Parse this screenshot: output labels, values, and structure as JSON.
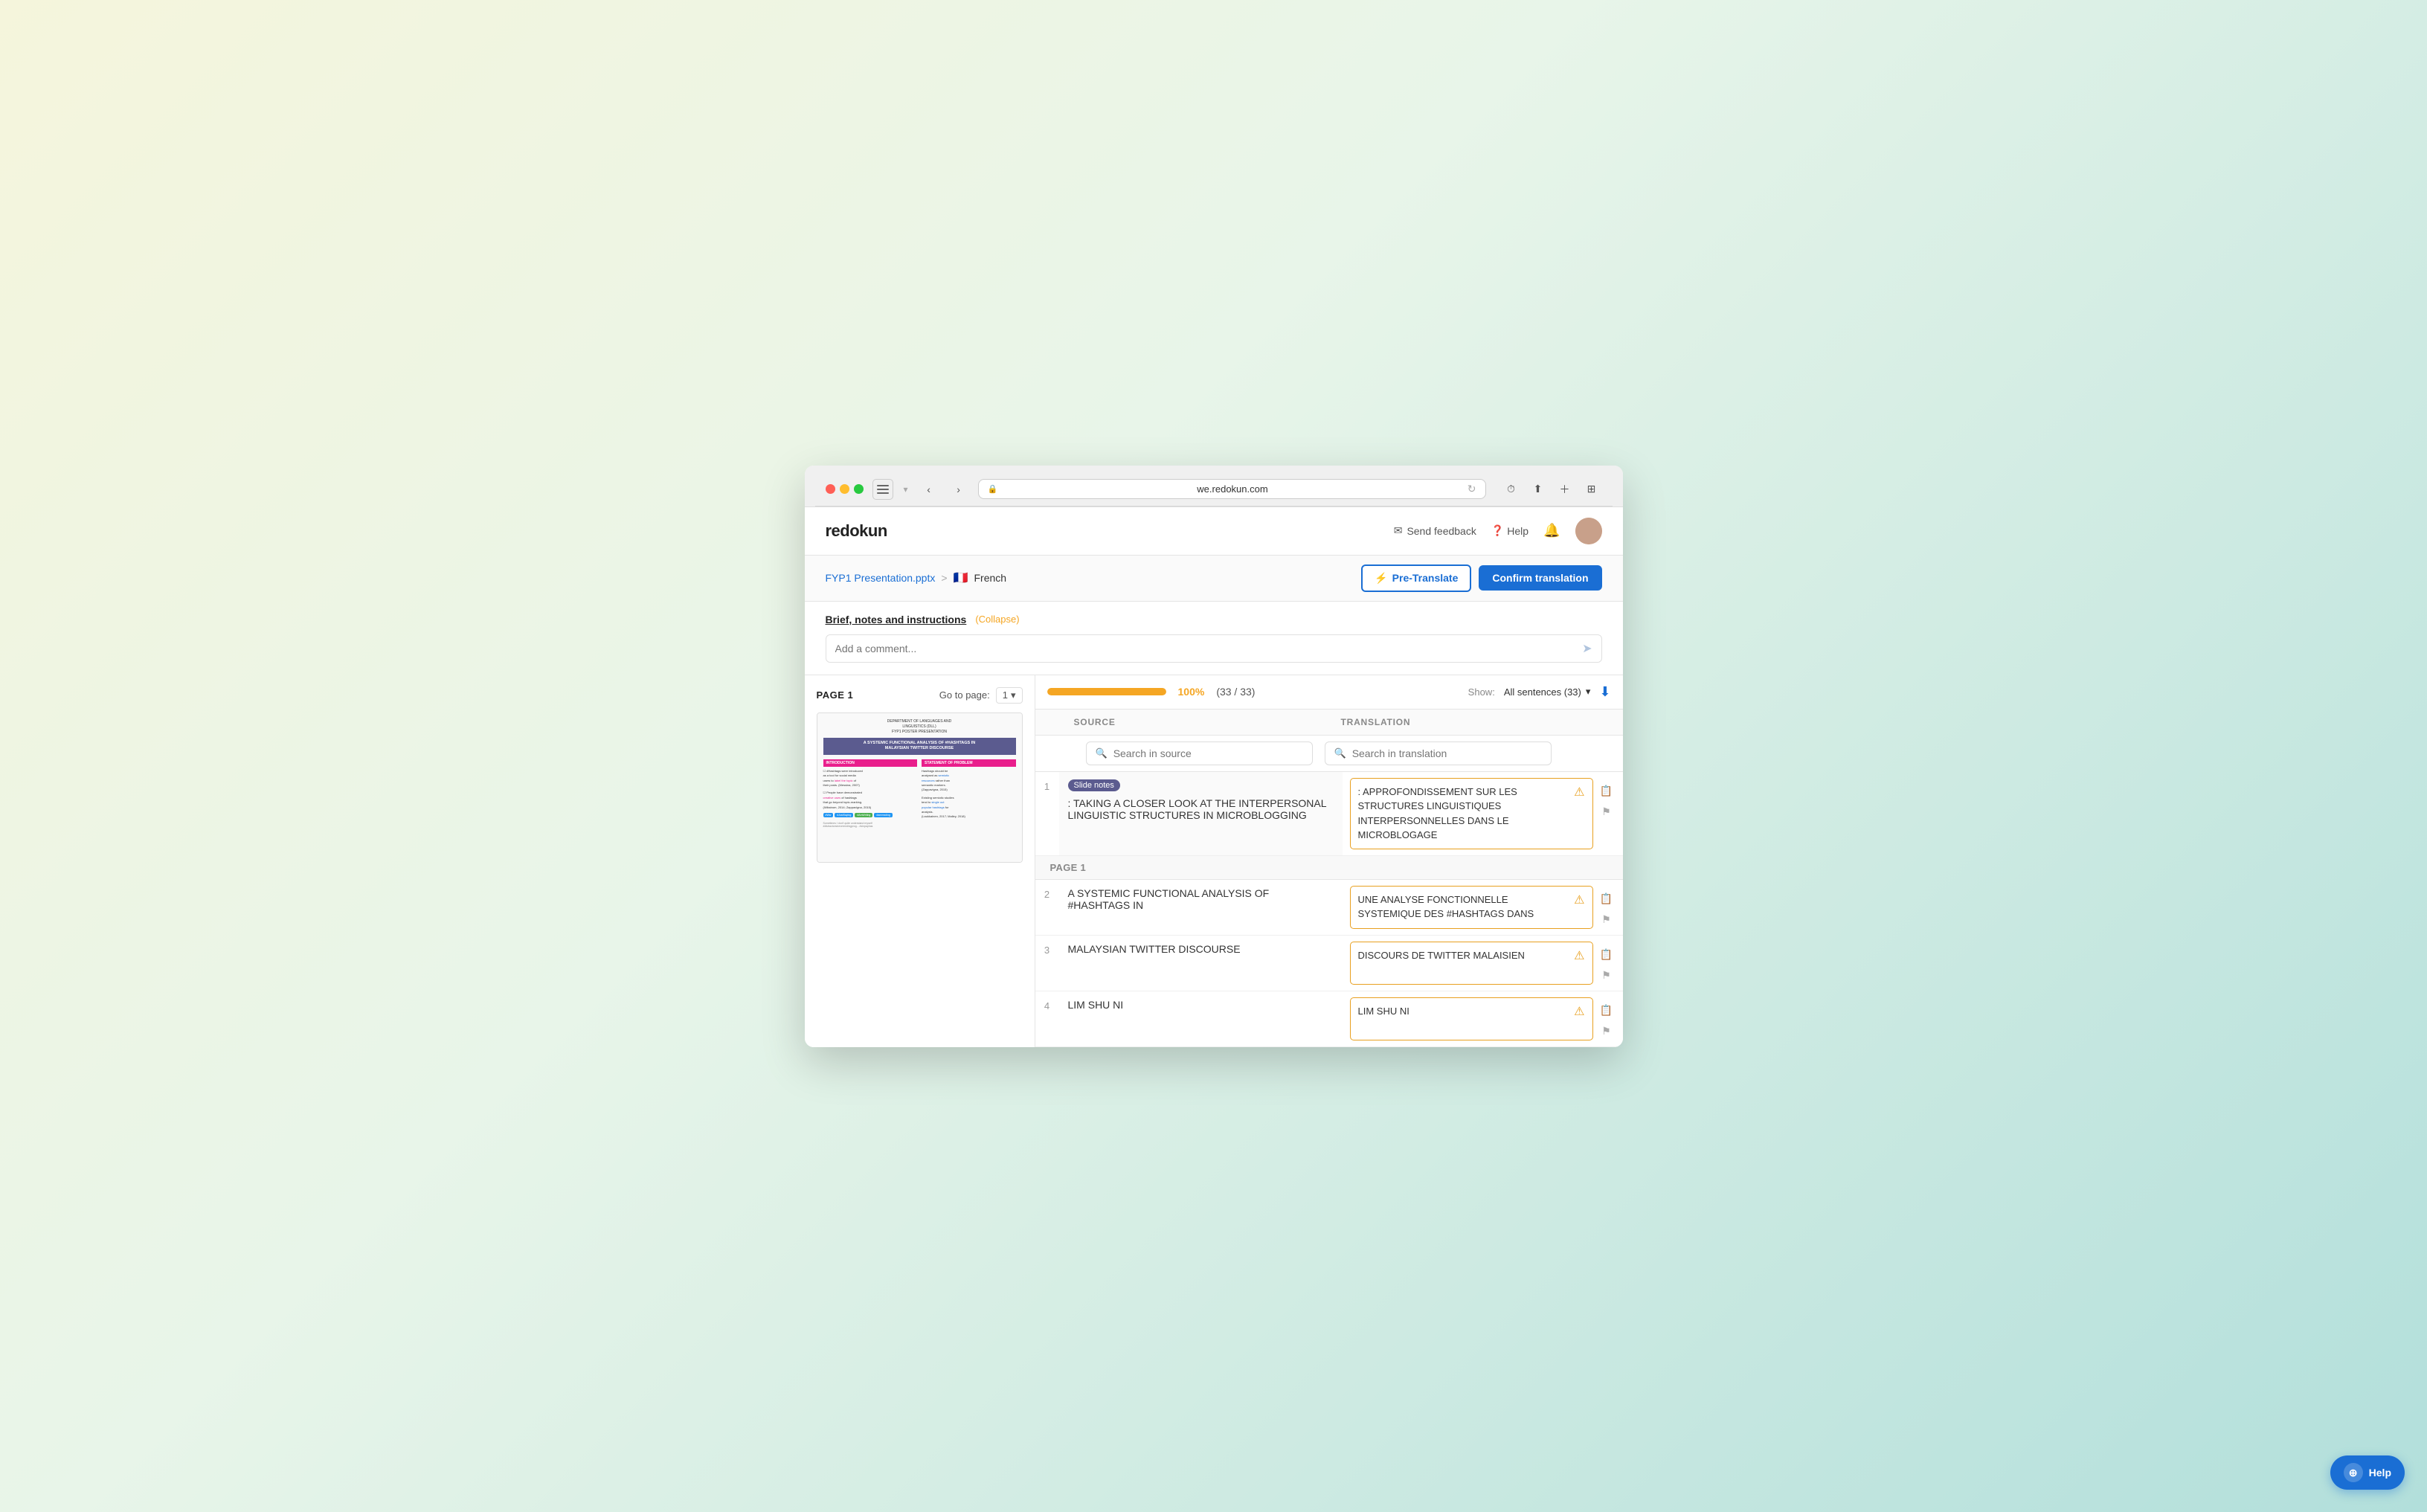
{
  "browser": {
    "url": "we.redokun.com",
    "tabs": [],
    "back_btn": "←",
    "forward_btn": "→"
  },
  "app": {
    "logo": "redokun",
    "header": {
      "send_feedback": "Send feedback",
      "help": "Help",
      "notification_icon": "🔔"
    },
    "breadcrumb": {
      "file": "FYP1 Presentation.pptx",
      "separator": ">",
      "language": "French"
    },
    "actions": {
      "pretranslate": "Pre-Translate",
      "confirm": "Confirm translation"
    },
    "brief": {
      "title": "Brief, notes and instructions",
      "collapse": "(Collapse)",
      "comment_placeholder": "Add a comment..."
    },
    "page_nav": {
      "page_label": "PAGE 1",
      "goto_label": "Go to page:",
      "page_num": "1"
    },
    "progress": {
      "percent": "100%",
      "count": "(33 / 33)",
      "show_label": "Show:",
      "show_value": "All sentences (33)"
    },
    "table": {
      "source_header": "SOURCE",
      "translation_header": "TRANSLATION",
      "search_source_placeholder": "Search in source",
      "search_translation_placeholder": "Search in translation"
    },
    "page_section": "PAGE 1",
    "rows": [
      {
        "num": "1",
        "has_badge": true,
        "badge_text": "Slide notes",
        "source": ": TAKING A CLOSER LOOK AT THE INTERPERSONAL LINGUISTIC STRUCTURES IN MICROBLOGGING",
        "translation": ": APPROFONDISSEMENT SUR LES STRUCTURES LINGUISTIQUES INTERPERSONNELLES DANS LE MICROBLOGAGE",
        "has_warning": true
      },
      {
        "num": "2",
        "has_badge": false,
        "badge_text": "",
        "source": "A SYSTEMIC FUNCTIONAL ANALYSIS OF #HASHTAGS IN",
        "translation": "UNE ANALYSE FONCTIONNELLE SYSTEMIQUE DES #HASHTAGS DANS",
        "has_warning": true
      },
      {
        "num": "3",
        "has_badge": false,
        "badge_text": "",
        "source": "MALAYSIAN TWITTER DISCOURSE",
        "translation": "DISCOURS DE TWITTER MALAISIEN",
        "has_warning": true
      },
      {
        "num": "4",
        "has_badge": false,
        "badge_text": "",
        "source": "LIM SHU NI",
        "translation": "LIM SHU NI",
        "has_warning": true
      }
    ],
    "help_widget": "Help"
  }
}
